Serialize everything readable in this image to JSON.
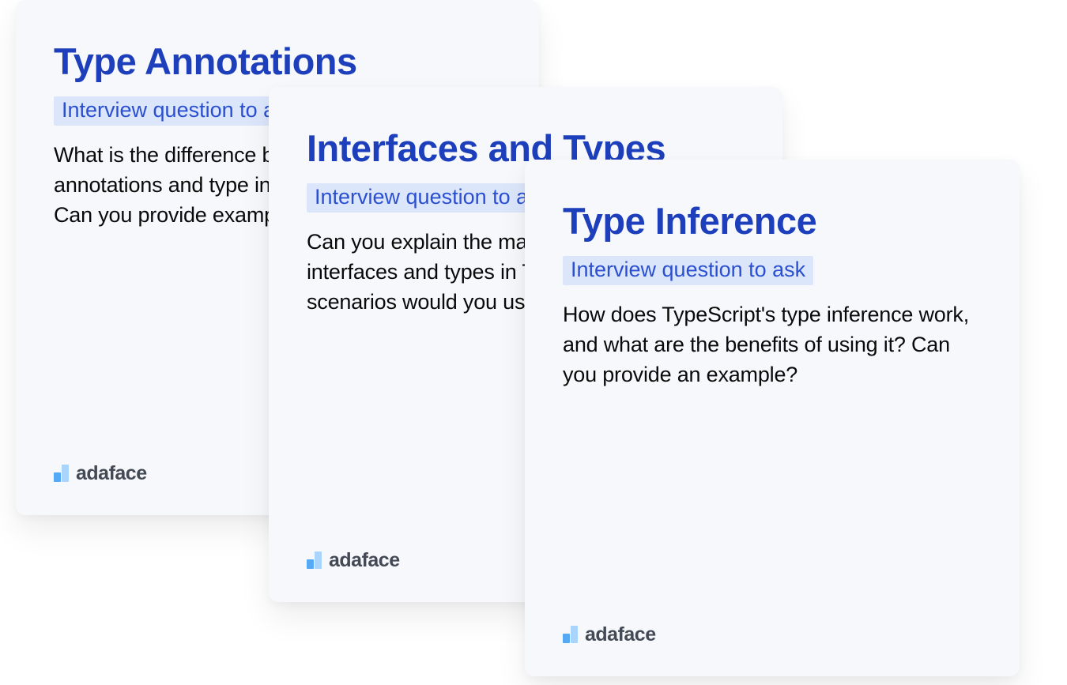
{
  "brand": "adaface",
  "tag_text": "Interview question to ask",
  "cards": [
    {
      "title": "Type Annotations",
      "body": "What is the difference between using type annotations and type inference in TypeScript? Can you provide examples of each?"
    },
    {
      "title": "Interfaces and Types",
      "body": "Can you explain the main differences between interfaces and types in TypeScript? In what scenarios would you use one over the other?"
    },
    {
      "title": "Type Inference",
      "body": "How does TypeScript's type inference work, and what are the benefits of using it? Can you provide an example?"
    }
  ]
}
